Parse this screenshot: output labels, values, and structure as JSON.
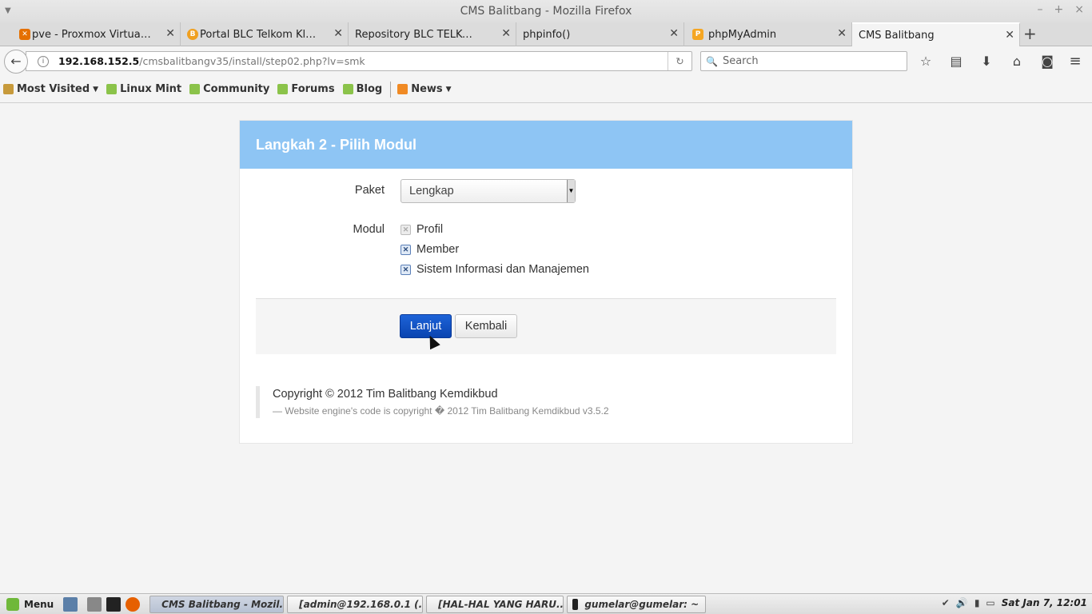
{
  "window": {
    "title": "CMS Balitbang - Mozilla Firefox"
  },
  "tabs": [
    {
      "label": "pve - Proxmox Virtual E...",
      "favicon_color": "#e57000"
    },
    {
      "label": "Portal BLC Telkom Klaten",
      "favicon_color": "#f0a020"
    },
    {
      "label": "Repository BLC TELKOM",
      "favicon_color": ""
    },
    {
      "label": "phpinfo()",
      "favicon_color": ""
    },
    {
      "label": "phpMyAdmin",
      "favicon_color": "#f5a623"
    },
    {
      "label": "CMS Balitbang",
      "favicon_color": ""
    }
  ],
  "nav": {
    "url_host": "192.168.152.5",
    "url_path": "/cmsbalitbangv35/install/step02.php?lv=smk",
    "search_placeholder": "Search"
  },
  "bookmarks": [
    {
      "label": "Most Visited"
    },
    {
      "label": "Linux Mint"
    },
    {
      "label": "Community"
    },
    {
      "label": "Forums"
    },
    {
      "label": "Blog"
    },
    {
      "label": "News"
    }
  ],
  "installer": {
    "heading": "Langkah 2 - Pilih Modul",
    "paket_label": "Paket",
    "paket_value": "Lengkap",
    "modul_label": "Modul",
    "modules": [
      {
        "label": "Profil",
        "checked": true,
        "disabled": true
      },
      {
        "label": "Member",
        "checked": true,
        "disabled": false
      },
      {
        "label": "Sistem Informasi dan Manajemen",
        "checked": true,
        "disabled": false
      }
    ],
    "next_button": "Lanjut",
    "back_button": "Kembali",
    "copyright": "Copyright © 2012 Tim Balitbang Kemdikbud",
    "engine_note": "— Website engine's code is copyright � 2012 Tim Balitbang Kemdikbud v3.5.2"
  },
  "taskbar": {
    "menu_label": "Menu",
    "tasks": [
      {
        "label": "CMS Balitbang - Mozil..."
      },
      {
        "label": "[admin@192.168.0.1 (..."
      },
      {
        "label": "[HAL-HAL YANG HARU..."
      },
      {
        "label": "gumelar@gumelar: ~"
      }
    ],
    "clock": "Sat Jan  7, 12:01"
  },
  "colors": {
    "header_blue": "#8ec5f4",
    "primary_button": "#0a44b0"
  }
}
